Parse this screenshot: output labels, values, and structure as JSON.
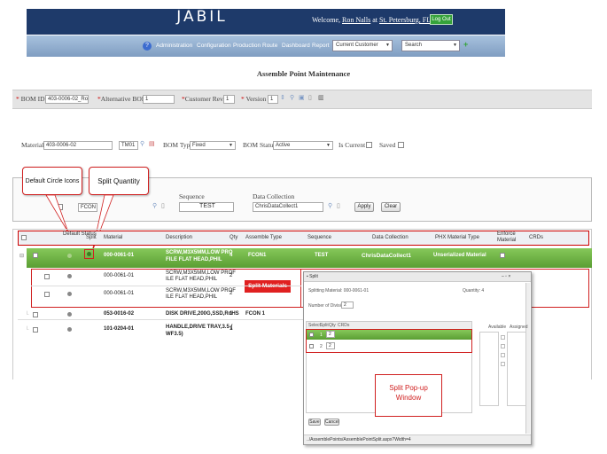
{
  "header": {
    "logo": "JABIL",
    "welcome_prefix": "Welcome,",
    "user": "Ron Nalls",
    "at": "at",
    "location": "St. Petersburg, FL",
    "logout": "Log Out"
  },
  "nav": {
    "items": [
      "Administration",
      "Configuration",
      "Production",
      "Route",
      "Dashboard",
      "Report"
    ],
    "customer_select": "Current Customer",
    "search_select": "Search"
  },
  "page_title": "Assemble Point Maintenance",
  "bom": {
    "bom_id_label": "BOM ID",
    "bom_id_value": "403-0006-02_Ron",
    "alt_bom_label": "Alternative BOM",
    "alt_bom_value": "1",
    "customer_rev_label": "Customer Rev.",
    "customer_rev_value": "1",
    "version_label": "Version",
    "version_value": "1"
  },
  "material": {
    "material_label": "Material",
    "material_value": "403-0006-02",
    "tm_value": "TM01",
    "bom_type_label": "BOM Type",
    "bom_type_value": "Fixed",
    "bom_status_label": "BOM Status",
    "bom_status_value": "Active",
    "is_current_label": "Is Current",
    "saved_label": "Saved"
  },
  "assembly": {
    "assembly_value": "FCON 1",
    "sequence_label": "Sequence",
    "sequence_value": "TEST",
    "data_collection_label": "Data Collection",
    "data_collection_value": "ChrisDataCollect1",
    "apply": "Apply",
    "clear": "Clear"
  },
  "grid": {
    "headers": {
      "default_status": "Default Status",
      "split": "Split",
      "material": "Material",
      "description": "Description",
      "qty": "Qty",
      "assemble_type": "Assemble Type",
      "sequence": "Sequence",
      "data_collection": "Data Collection",
      "phx_type": "PHX Material Type",
      "enforce": "Enforce Material",
      "crds": "CRDs"
    },
    "rows": [
      {
        "material": "000-0061-01",
        "desc1": "SCRW,M3X5MM,LOW PRO",
        "desc2": "FILE FLAT HEAD,PHIL",
        "qty": "4",
        "assemble_type": "FCON1",
        "sequence": "TEST",
        "data_collection": "ChrisDataCollect1",
        "phx_type": "Unserialized Material"
      },
      {
        "material": "000-0061-01",
        "desc1": "SCRW,M3X5MM,LOW PROF",
        "desc2": "ILE FLAT HEAD,PHIL",
        "qty": "2"
      },
      {
        "material": "000-0061-01",
        "desc1": "SCRW,M3X5MM,LOW PROF",
        "desc2": "ILE FLAT HEAD,PHIL",
        "qty": "2"
      },
      {
        "material": "053-0016-02",
        "desc1": "DISK DRIVE,200G,SSD,RoHS",
        "qty": "1",
        "assemble_type": "FCON 1"
      },
      {
        "material": "101-0204-01",
        "desc1": "HANDLE,DRIVE TRAY,3.5 (",
        "desc2": "WF3.5)",
        "qty": "1"
      }
    ]
  },
  "callouts": {
    "default_circle_icons": "Default Circle Icons",
    "split_quantity": "Split Quantity",
    "split_materials": "Split Materials",
    "split_popup_line1": "Split Pop-up",
    "split_popup_line2": "Window"
  },
  "popup": {
    "title": "Split",
    "splitting_material_label": "Splitting Material:",
    "splitting_material_value": "000-0061-01",
    "quantity_label": "Quantity:",
    "quantity_value": "4",
    "number_of_divisions_label": "Number of Divisions:",
    "number_of_divisions_value": "2",
    "cols": [
      "Select",
      "Split",
      "Qty",
      "CRDs"
    ],
    "rows": [
      {
        "split": "1",
        "qty": "2"
      },
      {
        "split": "2",
        "qty": "2"
      }
    ],
    "available": "Available",
    "assigned": "Assigned",
    "save": "Save",
    "cancel": "Cancel",
    "status_url": "../AssemblePoints/AssemblePointSplit.aspx?Width=4"
  }
}
